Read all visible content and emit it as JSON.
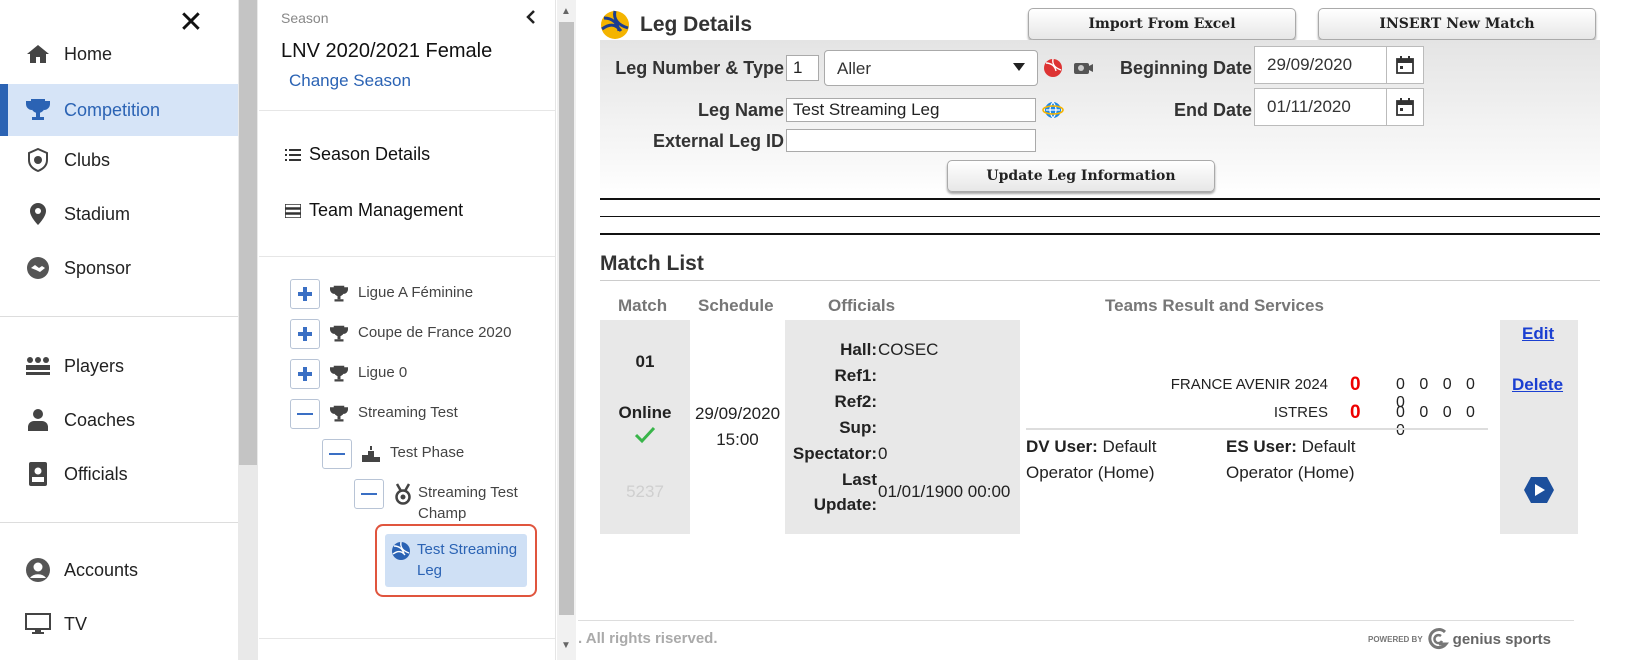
{
  "nav": {
    "items": [
      {
        "label": "Home",
        "icon": "home-icon"
      },
      {
        "label": "Competition",
        "icon": "trophy-icon",
        "active": true
      },
      {
        "label": "Clubs",
        "icon": "club-icon"
      },
      {
        "label": "Stadium",
        "icon": "location-pin-icon"
      },
      {
        "label": "Sponsor",
        "icon": "handshake-icon"
      },
      {
        "label": "Players",
        "icon": "players-icon"
      },
      {
        "label": "Coaches",
        "icon": "coach-icon"
      },
      {
        "label": "Officials",
        "icon": "id-badge-icon"
      },
      {
        "label": "Accounts",
        "icon": "account-icon"
      },
      {
        "label": "TV",
        "icon": "monitor-icon"
      }
    ],
    "close_symbol": "✕"
  },
  "season": {
    "caption": "Season",
    "name": "LNV 2020/2021 Female",
    "change_label": "Change Season",
    "menu": [
      {
        "label": "Season Details",
        "icon": "list-icon"
      },
      {
        "label": "Team Management",
        "icon": "team-list-icon"
      }
    ],
    "tree": [
      {
        "label": "Ligue A Féminine",
        "toggle": "+",
        "icon": "trophy-icon"
      },
      {
        "label": "Coupe de France 2020",
        "toggle": "+",
        "icon": "trophy-icon"
      },
      {
        "label": "Ligue 0",
        "toggle": "+",
        "icon": "trophy-icon"
      },
      {
        "label": "Streaming Test",
        "toggle": "—",
        "icon": "trophy-icon"
      },
      {
        "label": "Test Phase",
        "toggle": "—",
        "icon": "podium-icon"
      },
      {
        "label_line1": "Streaming Test",
        "label_line2": "Champ",
        "toggle": "—",
        "icon": "medal-icon"
      },
      {
        "label_line1": "Test Streaming",
        "label_line2": "Leg",
        "icon": "volleyball-icon",
        "selected": true
      }
    ]
  },
  "leg": {
    "title": "Leg Details",
    "import_label": "Import From Excel",
    "insert_label": "INSERT New Match",
    "number_type_label": "Leg Number & Type",
    "number_value": "1",
    "type_value": "Aller",
    "name_label": "Leg Name",
    "name_value": "Test Streaming Leg",
    "external_id_label": "External Leg ID",
    "external_id_value": "",
    "begin_label": "Beginning Date",
    "begin_value": "29/09/2020",
    "end_label": "End Date",
    "end_value": "01/11/2020",
    "update_label": "Update Leg Information"
  },
  "match_list": {
    "title": "Match List",
    "headers": [
      "Match",
      "Schedule",
      "Officials",
      "Teams Result and Services"
    ],
    "rows": [
      {
        "number": "01",
        "status": "Online",
        "id": "5237",
        "date": "29/09/2020",
        "time": "15:00",
        "officials": {
          "hall_label": "Hall:",
          "hall_value": "COSEC",
          "ref1_label": "Ref1:",
          "ref1_value": "",
          "ref2_label": "Ref2:",
          "ref2_value": "",
          "sup_label": "Sup:",
          "sup_value": "",
          "spectator_label": "Spectator:",
          "spectator_value": "0",
          "last_label": "Last",
          "update_label": "Update:",
          "last_update_value": "01/01/1900 00:00"
        },
        "home_team": "FRANCE AVENIR 2024",
        "home_score": "0",
        "home_sets": "0 0 0 0 0",
        "away_team": "ISTRES",
        "away_score": "0",
        "away_sets": "0 0 0 0 0",
        "dv_user_label": "DV User:",
        "dv_user_value_1": "Default",
        "dv_user_value_2": "Operator (Home)",
        "es_user_label": "ES User:",
        "es_user_value_1": "Default",
        "es_user_value_2": "Operator (Home)",
        "edit_label": "Edit",
        "delete_label": "Delete"
      }
    ]
  },
  "footer": {
    "rights": ". All rights riserved.",
    "powered_by": "POWERED BY",
    "brand": "genius sports"
  },
  "colors": {
    "accent": "#2b63b4",
    "active_bg": "#d6e4f7",
    "score_red": "#ee0000",
    "link_blue": "#1a3fd1",
    "highlight_border": "#e0553e"
  }
}
